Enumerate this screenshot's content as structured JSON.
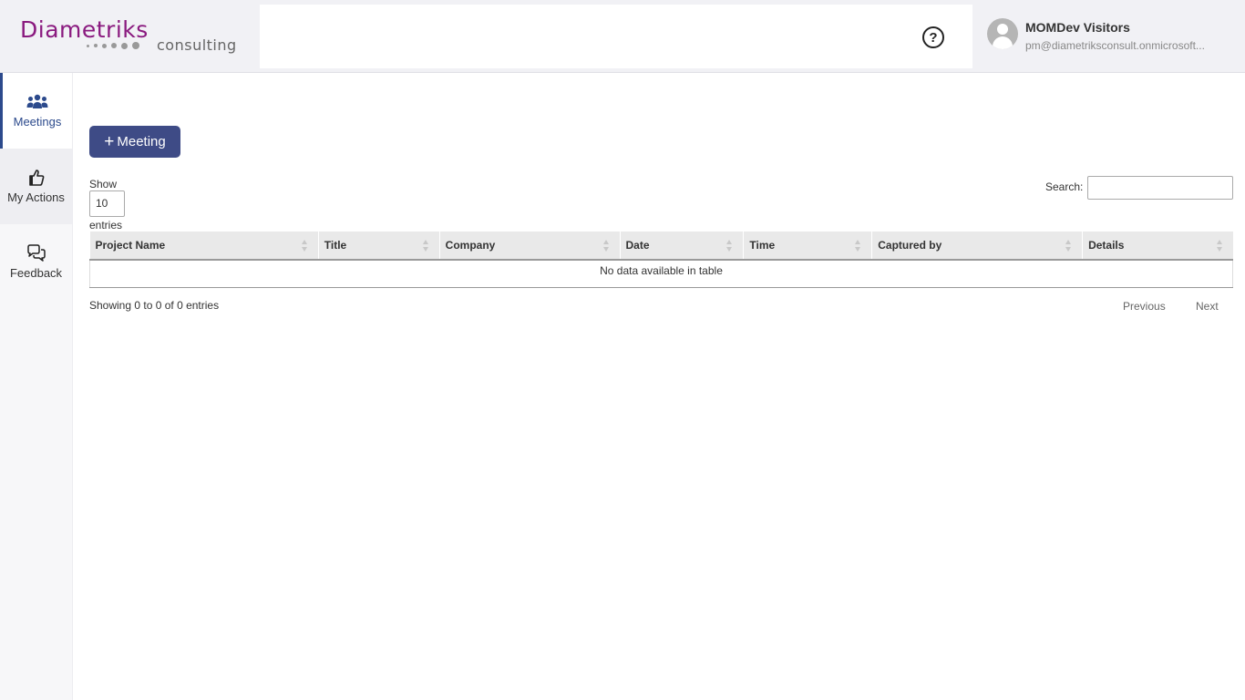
{
  "header": {
    "logo_main": "Diametriks",
    "logo_sub": "consulting",
    "help_symbol": "?",
    "user": {
      "name": "MOMDev Visitors",
      "email": "pm@diametriksconsult.onmicrosoft..."
    }
  },
  "sidebar": {
    "items": [
      {
        "label": "Meetings",
        "icon": "people-group-icon",
        "active": true
      },
      {
        "label": "My Actions",
        "icon": "thumbs-up-icon",
        "active": false
      },
      {
        "label": "Feedback",
        "icon": "chat-bubbles-icon",
        "active": false
      }
    ]
  },
  "main": {
    "add_button": {
      "plus": "+",
      "label": "Meeting"
    },
    "length": {
      "show_label": "Show",
      "selected": "10",
      "entries_label": "entries"
    },
    "search": {
      "label": "Search:",
      "value": ""
    },
    "table": {
      "columns": [
        "Project Name",
        "Title",
        "Company",
        "Date",
        "Time",
        "Captured by",
        "Details"
      ],
      "empty_message": "No data available in table"
    },
    "info": "Showing 0 to 0 of 0 entries",
    "pagination": {
      "previous": "Previous",
      "next": "Next"
    }
  },
  "colors": {
    "brand_purple": "#8a1a7f",
    "primary_button": "#3e4b86",
    "active_nav": "#2c4a8c"
  }
}
